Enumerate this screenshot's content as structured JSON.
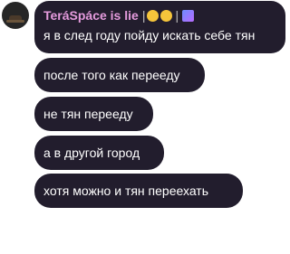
{
  "sender": {
    "name": "TeráSpáce is lie",
    "separator_left": "|",
    "separator_right": "|"
  },
  "messages": [
    {
      "text": "я в след году пойду искать себе тян"
    },
    {
      "text": "после того как перееду"
    },
    {
      "text": "не тян перееду"
    },
    {
      "text": "а в другой город"
    },
    {
      "text": "хотя можно и тян переехать"
    }
  ]
}
